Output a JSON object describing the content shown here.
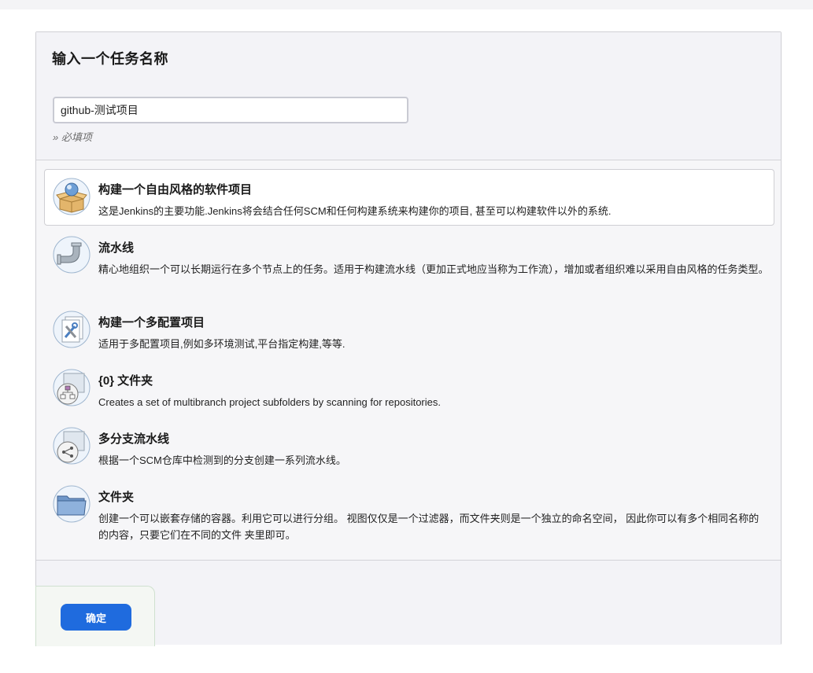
{
  "header": {
    "title": "输入一个任务名称",
    "name_value": "github-测试项目",
    "required_note": "» 必填项"
  },
  "item_types": [
    {
      "title": "构建一个自由风格的软件项目",
      "description": "这是Jenkins的主要功能.Jenkins将会结合任何SCM和任何构建系统来构建你的项目, 甚至可以构建软件以外的系统.",
      "icon": "freestyle-project-icon",
      "selected": true
    },
    {
      "title": "流水线",
      "description": "精心地组织一个可以长期运行在多个节点上的任务。适用于构建流水线（更加正式地应当称为工作流），增加或者组织难以采用自由风格的任务类型。",
      "icon": "pipeline-icon",
      "selected": false
    },
    {
      "title": "构建一个多配置项目",
      "description": "适用于多配置项目,例如多环境测试,平台指定构建,等等.",
      "icon": "multi-config-project-icon",
      "selected": false
    },
    {
      "title": "{0} 文件夹",
      "description": "Creates a set of multibranch project subfolders by scanning for repositories.",
      "icon": "organization-folder-icon",
      "selected": false
    },
    {
      "title": "多分支流水线",
      "description": "根据一个SCM仓库中检测到的分支创建一系列流水线。",
      "icon": "multibranch-pipeline-icon",
      "selected": false
    },
    {
      "title": "文件夹",
      "description": "创建一个可以嵌套存储的容器。利用它可以进行分组。 视图仅仅是一个过滤器，而文件夹则是一个独立的命名空间， 因此你可以有多个相同名称的的内容，只要它们在不同的文件 夹里即可。",
      "icon": "folder-icon",
      "selected": false
    }
  ],
  "footer": {
    "ok_label": "确定"
  },
  "colors": {
    "accent": "#1f6bde",
    "panel_bg": "#f6f6f8"
  }
}
